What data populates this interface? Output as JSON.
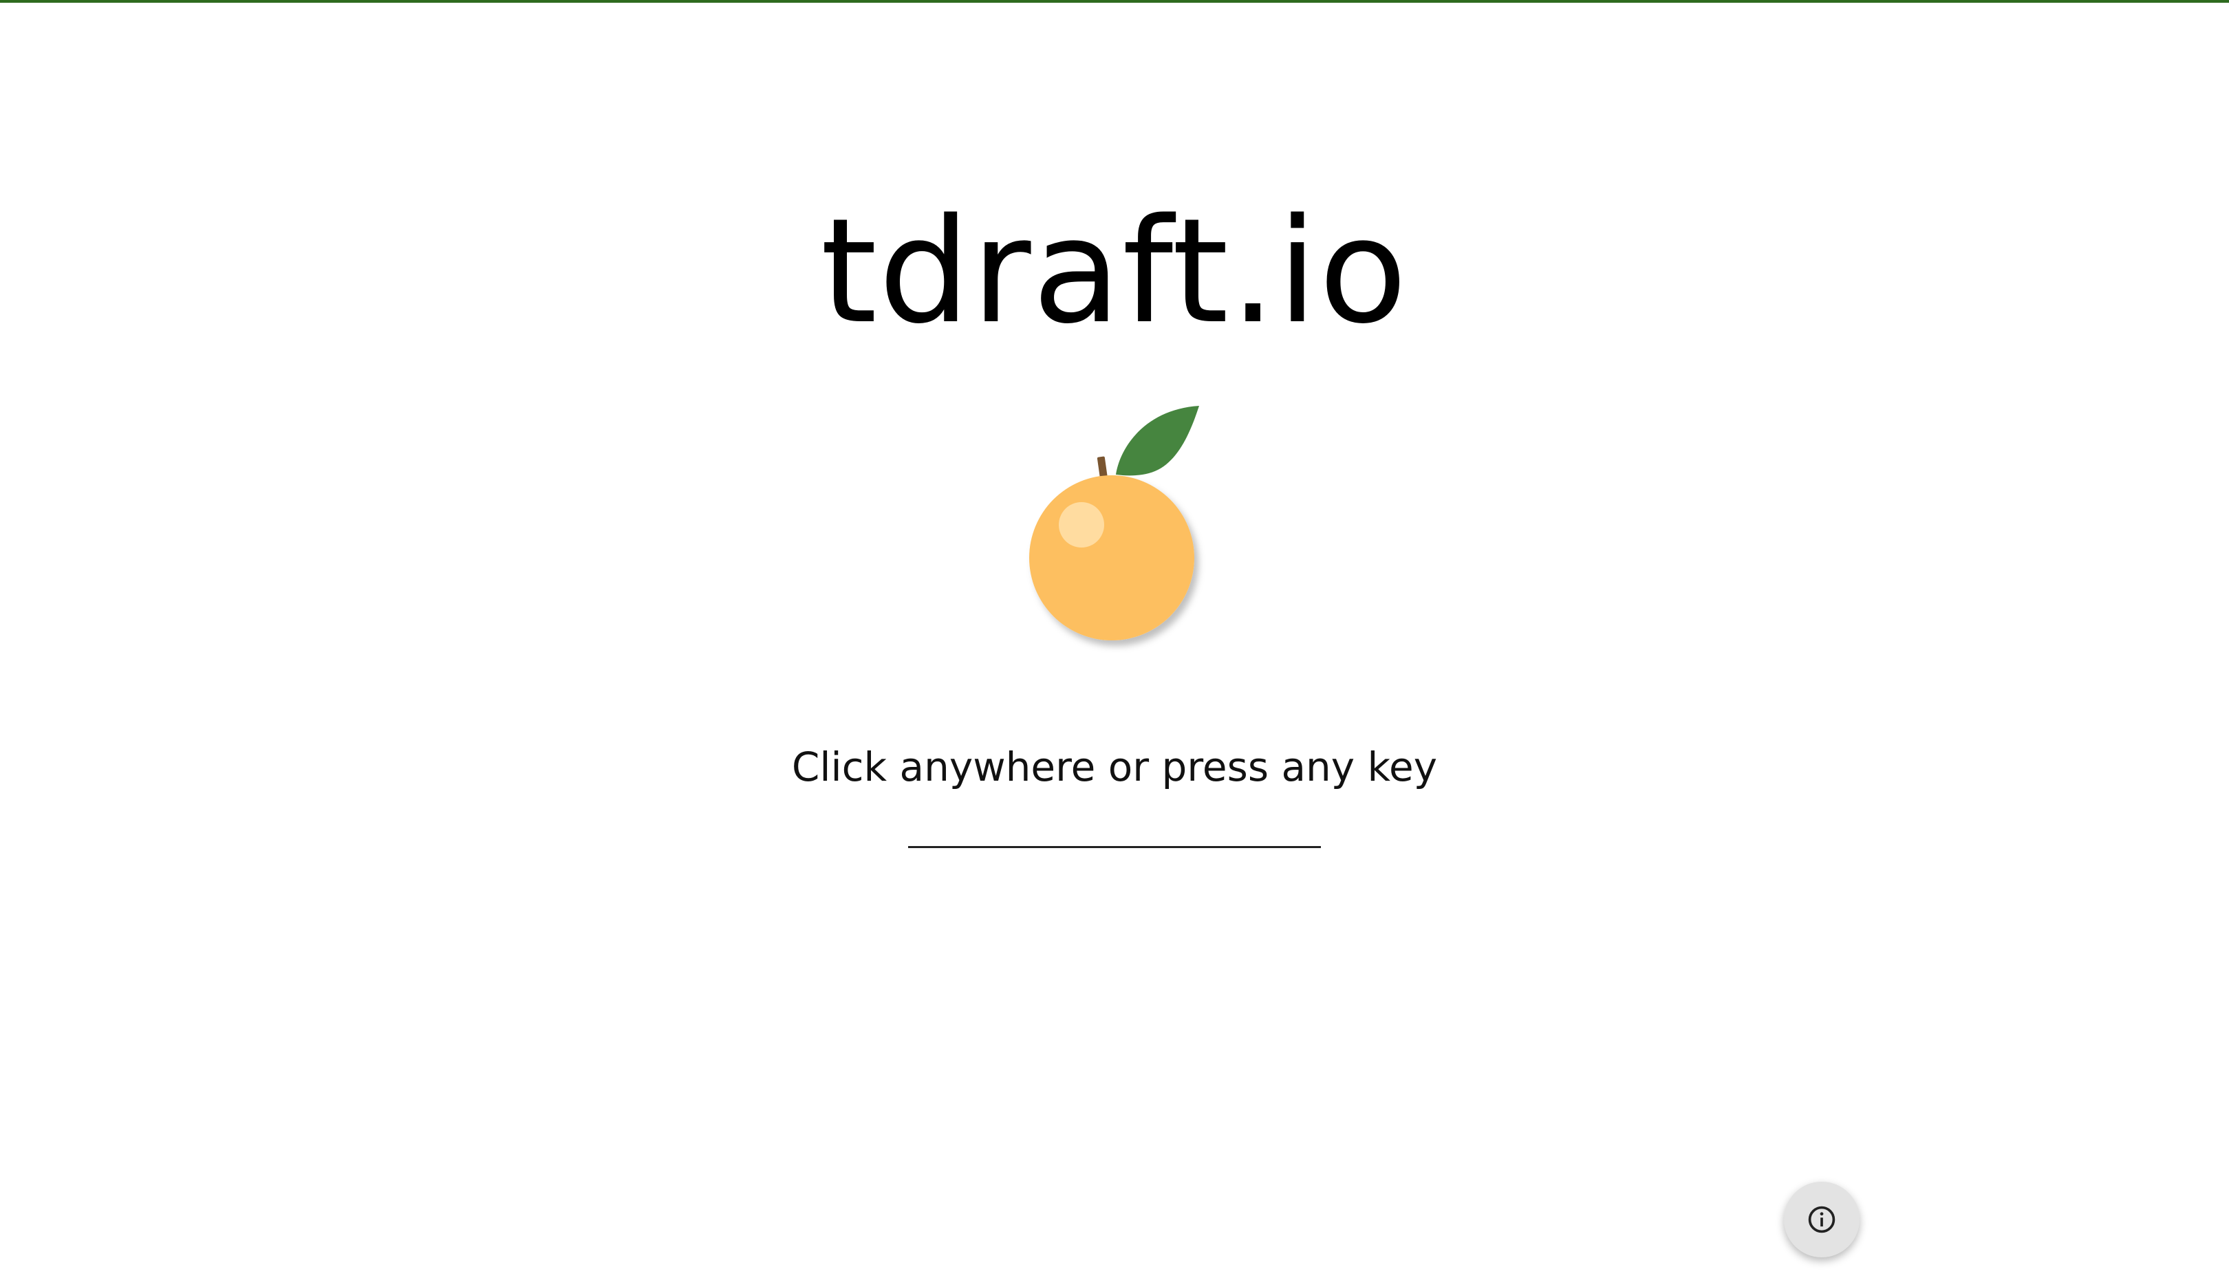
{
  "app": {
    "title": "tdraft.io",
    "prompt": "Click anywhere or press any key"
  },
  "icons": {
    "logo": "orange-fruit-icon",
    "info": "info-icon"
  },
  "colors": {
    "top_bar": "#2e6b1f",
    "orange": "#fdbf60",
    "leaf": "#46853f",
    "stem": "#7a5530"
  }
}
